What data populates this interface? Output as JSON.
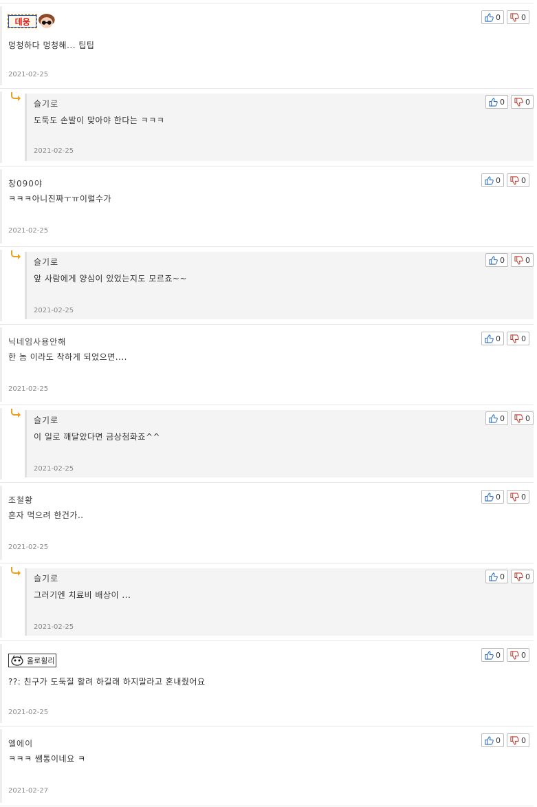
{
  "comments": [
    {
      "nick": "",
      "image_nick_text": "데웅",
      "text": "멍청하다 멍청해... 팁팁",
      "date": "2021-02-25",
      "up": "0",
      "down": "0"
    },
    {
      "nick": "슬기로",
      "text": "도둑도 손발이 맞아야 한다는 ㅋㅋㅋ",
      "date": "2021-02-25",
      "up": "0",
      "down": "0"
    },
    {
      "nick": "창090야",
      "text": "ㅋㅋㅋ아니진짜ㅜㅠ이럴수가",
      "date": "2021-02-25",
      "up": "0",
      "down": "0"
    },
    {
      "nick": "슬기로",
      "text": "앞 사람에게 양심이 있었는지도 모르죠~~",
      "date": "2021-02-25",
      "up": "0",
      "down": "0"
    },
    {
      "nick": "닉네임사용안해",
      "text": "한 놈 이라도 착하게 되었으면....",
      "date": "2021-02-25",
      "up": "0",
      "down": "0"
    },
    {
      "nick": "슬기로",
      "text": "이 일로 깨달았다면 금상첨화죠^^",
      "date": "2021-02-25",
      "up": "0",
      "down": "0"
    },
    {
      "nick": "조철황",
      "text": "혼자 먹으려 한건가..",
      "date": "2021-02-25",
      "up": "0",
      "down": "0"
    },
    {
      "nick": "슬기로",
      "text": "그러기엔 치료비 배상이 ...",
      "date": "2021-02-25",
      "up": "0",
      "down": "0"
    },
    {
      "nick": "",
      "image_nick_text": "올로휠리",
      "text": "??: 친구가 도둑질 할려 하길래 하지말라고 혼내줬어요",
      "date": "2021-02-25",
      "up": "0",
      "down": "0"
    },
    {
      "nick": "엘에이",
      "text": "ㅋㅋㅋ 쌤통이네요 ㅋ",
      "date": "2021-02-27",
      "up": "0",
      "down": "0"
    }
  ],
  "icons": {
    "reply_arrow": "reply-arrow-icon",
    "up": "thumbs-up-icon",
    "down": "thumbs-down-icon"
  },
  "colors": {
    "reply_arrow": "#e8a020",
    "reply_bg": "#f4f4f4",
    "date": "#888888"
  }
}
